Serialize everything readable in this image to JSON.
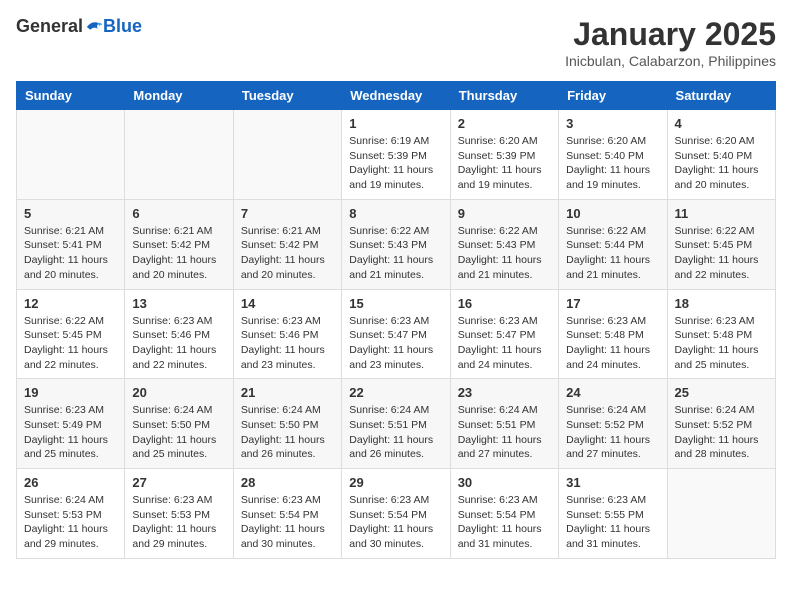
{
  "header": {
    "logo_general": "General",
    "logo_blue": "Blue",
    "month_title": "January 2025",
    "location": "Inicbulan, Calabarzon, Philippines"
  },
  "weekdays": [
    "Sunday",
    "Monday",
    "Tuesday",
    "Wednesday",
    "Thursday",
    "Friday",
    "Saturday"
  ],
  "weeks": [
    [
      {
        "day": "",
        "info": ""
      },
      {
        "day": "",
        "info": ""
      },
      {
        "day": "",
        "info": ""
      },
      {
        "day": "1",
        "info": "Sunrise: 6:19 AM\nSunset: 5:39 PM\nDaylight: 11 hours and 19 minutes."
      },
      {
        "day": "2",
        "info": "Sunrise: 6:20 AM\nSunset: 5:39 PM\nDaylight: 11 hours and 19 minutes."
      },
      {
        "day": "3",
        "info": "Sunrise: 6:20 AM\nSunset: 5:40 PM\nDaylight: 11 hours and 19 minutes."
      },
      {
        "day": "4",
        "info": "Sunrise: 6:20 AM\nSunset: 5:40 PM\nDaylight: 11 hours and 20 minutes."
      }
    ],
    [
      {
        "day": "5",
        "info": "Sunrise: 6:21 AM\nSunset: 5:41 PM\nDaylight: 11 hours and 20 minutes."
      },
      {
        "day": "6",
        "info": "Sunrise: 6:21 AM\nSunset: 5:42 PM\nDaylight: 11 hours and 20 minutes."
      },
      {
        "day": "7",
        "info": "Sunrise: 6:21 AM\nSunset: 5:42 PM\nDaylight: 11 hours and 20 minutes."
      },
      {
        "day": "8",
        "info": "Sunrise: 6:22 AM\nSunset: 5:43 PM\nDaylight: 11 hours and 21 minutes."
      },
      {
        "day": "9",
        "info": "Sunrise: 6:22 AM\nSunset: 5:43 PM\nDaylight: 11 hours and 21 minutes."
      },
      {
        "day": "10",
        "info": "Sunrise: 6:22 AM\nSunset: 5:44 PM\nDaylight: 11 hours and 21 minutes."
      },
      {
        "day": "11",
        "info": "Sunrise: 6:22 AM\nSunset: 5:45 PM\nDaylight: 11 hours and 22 minutes."
      }
    ],
    [
      {
        "day": "12",
        "info": "Sunrise: 6:22 AM\nSunset: 5:45 PM\nDaylight: 11 hours and 22 minutes."
      },
      {
        "day": "13",
        "info": "Sunrise: 6:23 AM\nSunset: 5:46 PM\nDaylight: 11 hours and 22 minutes."
      },
      {
        "day": "14",
        "info": "Sunrise: 6:23 AM\nSunset: 5:46 PM\nDaylight: 11 hours and 23 minutes."
      },
      {
        "day": "15",
        "info": "Sunrise: 6:23 AM\nSunset: 5:47 PM\nDaylight: 11 hours and 23 minutes."
      },
      {
        "day": "16",
        "info": "Sunrise: 6:23 AM\nSunset: 5:47 PM\nDaylight: 11 hours and 24 minutes."
      },
      {
        "day": "17",
        "info": "Sunrise: 6:23 AM\nSunset: 5:48 PM\nDaylight: 11 hours and 24 minutes."
      },
      {
        "day": "18",
        "info": "Sunrise: 6:23 AM\nSunset: 5:48 PM\nDaylight: 11 hours and 25 minutes."
      }
    ],
    [
      {
        "day": "19",
        "info": "Sunrise: 6:23 AM\nSunset: 5:49 PM\nDaylight: 11 hours and 25 minutes."
      },
      {
        "day": "20",
        "info": "Sunrise: 6:24 AM\nSunset: 5:50 PM\nDaylight: 11 hours and 25 minutes."
      },
      {
        "day": "21",
        "info": "Sunrise: 6:24 AM\nSunset: 5:50 PM\nDaylight: 11 hours and 26 minutes."
      },
      {
        "day": "22",
        "info": "Sunrise: 6:24 AM\nSunset: 5:51 PM\nDaylight: 11 hours and 26 minutes."
      },
      {
        "day": "23",
        "info": "Sunrise: 6:24 AM\nSunset: 5:51 PM\nDaylight: 11 hours and 27 minutes."
      },
      {
        "day": "24",
        "info": "Sunrise: 6:24 AM\nSunset: 5:52 PM\nDaylight: 11 hours and 27 minutes."
      },
      {
        "day": "25",
        "info": "Sunrise: 6:24 AM\nSunset: 5:52 PM\nDaylight: 11 hours and 28 minutes."
      }
    ],
    [
      {
        "day": "26",
        "info": "Sunrise: 6:24 AM\nSunset: 5:53 PM\nDaylight: 11 hours and 29 minutes."
      },
      {
        "day": "27",
        "info": "Sunrise: 6:23 AM\nSunset: 5:53 PM\nDaylight: 11 hours and 29 minutes."
      },
      {
        "day": "28",
        "info": "Sunrise: 6:23 AM\nSunset: 5:54 PM\nDaylight: 11 hours and 30 minutes."
      },
      {
        "day": "29",
        "info": "Sunrise: 6:23 AM\nSunset: 5:54 PM\nDaylight: 11 hours and 30 minutes."
      },
      {
        "day": "30",
        "info": "Sunrise: 6:23 AM\nSunset: 5:54 PM\nDaylight: 11 hours and 31 minutes."
      },
      {
        "day": "31",
        "info": "Sunrise: 6:23 AM\nSunset: 5:55 PM\nDaylight: 11 hours and 31 minutes."
      },
      {
        "day": "",
        "info": ""
      }
    ]
  ]
}
